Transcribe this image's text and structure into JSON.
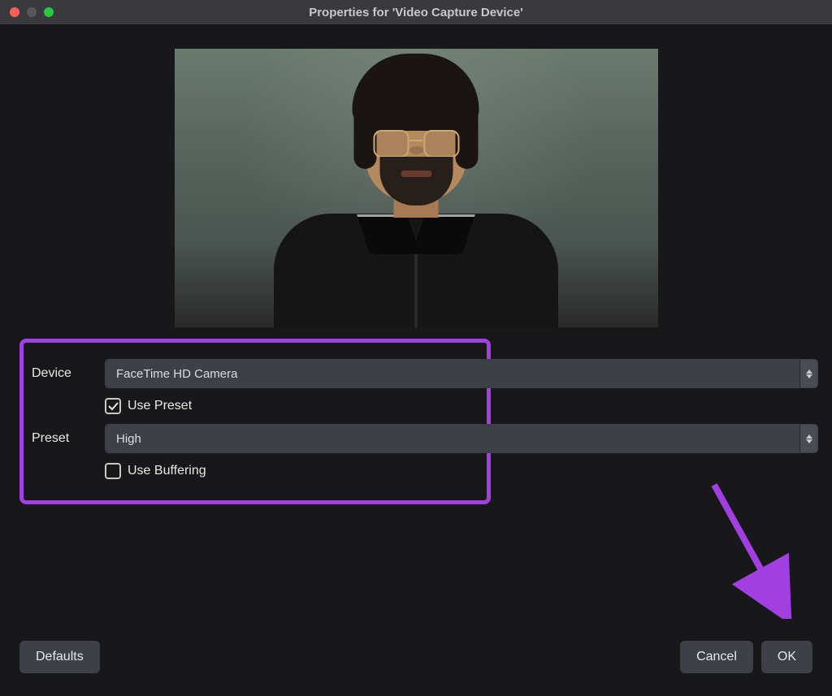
{
  "window": {
    "title": "Properties for 'Video Capture Device'"
  },
  "form": {
    "device_label": "Device",
    "device_value": "FaceTime HD Camera",
    "use_preset_label": "Use Preset",
    "use_preset_checked": true,
    "preset_label": "Preset",
    "preset_value": "High",
    "use_buffering_label": "Use Buffering",
    "use_buffering_checked": false
  },
  "footer": {
    "defaults": "Defaults",
    "cancel": "Cancel",
    "ok": "OK"
  },
  "annotation": {
    "highlight_color": "#a23fe0",
    "arrow_points_to": "ok-button"
  }
}
